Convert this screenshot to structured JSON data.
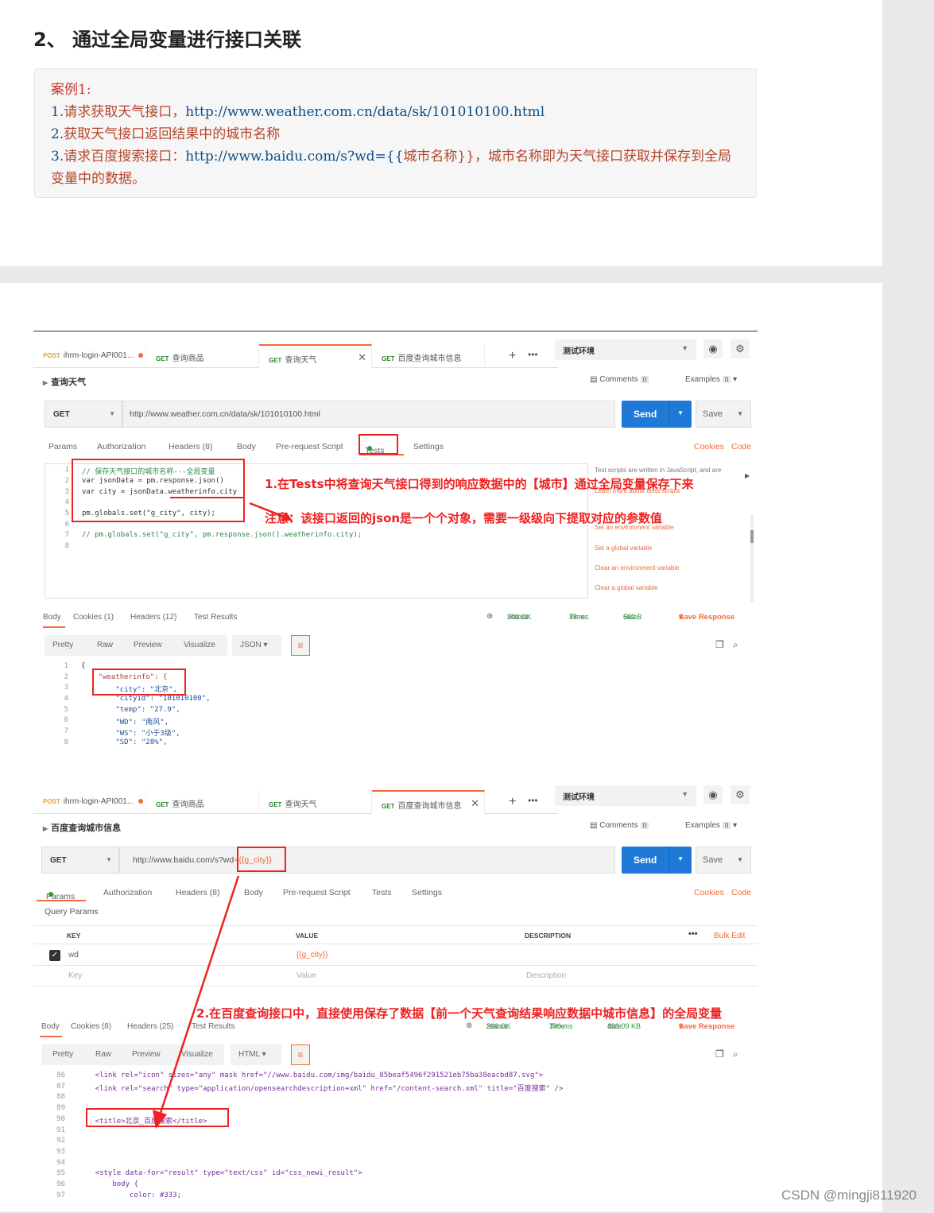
{
  "article": {
    "heading": "2、 通过全局变量进行接口关联",
    "case_title": "案例1:",
    "case_lines": [
      {
        "n": "1.",
        "t": "请求获取天气接口，",
        "code": "http://www.weather.com.cn/data/sk/101010100.html",
        "rest": ""
      },
      {
        "n": "2.",
        "t": "获取天气接口返回结果中的城市名称",
        "code": "",
        "rest": ""
      },
      {
        "n": "3.",
        "t": "请求百度搜索接口：",
        "code": "http://www.baidu.com/s?wd={{",
        "rest": "城市名称}}，城市名称即为天气接口获取并保存到全局变量中的数据。"
      }
    ]
  },
  "shot1": {
    "tabs": [
      {
        "method": "POST",
        "name": "ihrm-login-API001...",
        "dot": true
      },
      {
        "method": "GET",
        "name": "查询商品"
      },
      {
        "method": "GET",
        "name": "查询天气",
        "active": true,
        "close": "✕"
      },
      {
        "method": "GET",
        "name": "百度查询城市信息"
      }
    ],
    "env": "测试环境",
    "title": "查询天气",
    "comments": "Comments",
    "comments_n": "0",
    "examples": "Examples",
    "examples_n": "0",
    "method": "GET",
    "url": "http://www.weather.com.cn/data/sk/101010100.html",
    "send": "Send",
    "save": "Save",
    "req_tabs": [
      "Params",
      "Authorization",
      "Headers (8)",
      "Body",
      "Pre-request Script",
      "Tests",
      "Settings"
    ],
    "cookies": "Cookies",
    "code": "Code",
    "code_lines": [
      "// 保存天气接口的城市名称---全局变量",
      "var jsonData = pm.response.json()",
      "var city = jsonData.weatherinfo.city",
      "",
      "pm.globals.set(\"g_city\", city);",
      "",
      "// pm.globals.set(\"g_city\", pm.response.json().weatherinfo.city);",
      ""
    ],
    "side_intro": "Test scripts are written in JavaScript, and are",
    "side_learn": "Learn more about tests scripts",
    "side_links": [
      "Set an environment variable",
      "Set a global variable",
      "Clear an environment variable",
      "Clear a global variable"
    ],
    "res_tabs": [
      "Body",
      "Cookies (1)",
      "Headers (12)",
      "Test Results"
    ],
    "status_label": "Status:",
    "status": "200 OK",
    "time_label": "Time:",
    "time": "48 ms",
    "size_label": "Size:",
    "size": "662 B",
    "save_response": "Save Response",
    "views": [
      "Pretty",
      "Raw",
      "Preview",
      "Visualize"
    ],
    "format": "JSON",
    "json_lines": [
      "{",
      "    \"weatherinfo\": {",
      "        \"city\": \"北京\",",
      "        \"cityid\": \"101010100\",",
      "        \"temp\": \"27.9\",",
      "        \"WD\": \"南风\",",
      "        \"WS\": \"小于3级\",",
      "        \"SD\": \"28%\","
    ],
    "annotation1": "1.在Tests中将查询天气接口得到的响应数据中的【城市】通过全局变量保存下来",
    "annotation2": "注意：该接口返回的json是一个个对象，需要一级级向下提取对应的参数值"
  },
  "shot2": {
    "tabs": [
      {
        "method": "POST",
        "name": "ihrm-login-API001...",
        "dot": true
      },
      {
        "method": "GET",
        "name": "查询商品"
      },
      {
        "method": "GET",
        "name": "查询天气"
      },
      {
        "method": "GET",
        "name": "百度查询城市信息",
        "active": true,
        "close": "✕"
      }
    ],
    "env": "测试环境",
    "title": "百度查询城市信息",
    "comments": "Comments",
    "comments_n": "0",
    "examples": "Examples",
    "examples_n": "0",
    "method": "GET",
    "url_base": "http://www.baidu.com/s?wd",
    "url_var": "={{g_city}}",
    "send": "Send",
    "save": "Save",
    "req_tabs": [
      "Params",
      "Authorization",
      "Headers (8)",
      "Body",
      "Pre-request Script",
      "Tests",
      "Settings"
    ],
    "cookies": "Cookies",
    "code": "Code",
    "query_params": "Query Params",
    "cols": [
      "KEY",
      "VALUE",
      "DESCRIPTION"
    ],
    "bulk_edit": "Bulk Edit",
    "row": {
      "key": "wd",
      "value": "{{g_city}}"
    },
    "ph": {
      "key": "Key",
      "value": "Value",
      "desc": "Description"
    },
    "res_tabs": [
      "Body",
      "Cookies (8)",
      "Headers (25)",
      "Test Results"
    ],
    "status_label": "Status:",
    "status": "200 OK",
    "time_label": "Time:",
    "time": "390 ms",
    "size_label": "Size:",
    "size": "493.09 KB",
    "save_response": "Save Response",
    "views": [
      "Pretty",
      "Raw",
      "Preview",
      "Visualize"
    ],
    "format": "HTML",
    "line_nums": [
      "86",
      "87",
      "88",
      "89",
      "90",
      "91",
      "92",
      "93",
      "94",
      "95",
      "96",
      "97"
    ],
    "html_lines": [
      "    <link rel=\"icon\" sizes=\"any\" mask href=\"//www.baidu.com/img/baidu_85beaf5496f291521eb75ba38eacbd87.svg\">",
      "    <link rel=\"search\" type=\"application/opensearchdescription+xml\" href=\"/content-search.xml\" title=\"百度搜索\" />",
      "",
      "",
      "    <title>北京_百度搜索</title>",
      "",
      "",
      "",
      "",
      "    <style data-for=\"result\" type=\"text/css\" id=\"css_newi_result\">",
      "        body {",
      "            color: #333;"
    ],
    "annotation": "2.在百度查询接口中，直接使用保存了数据【前一个天气查询结果响应数据中城市信息】的全局变量"
  },
  "watermark": "CSDN @mingji811920",
  "colors": {
    "accent": "#f26b3a",
    "send": "#1e7ad6",
    "annotation": "#ee2222",
    "status_ok": "#2a9a3a"
  }
}
